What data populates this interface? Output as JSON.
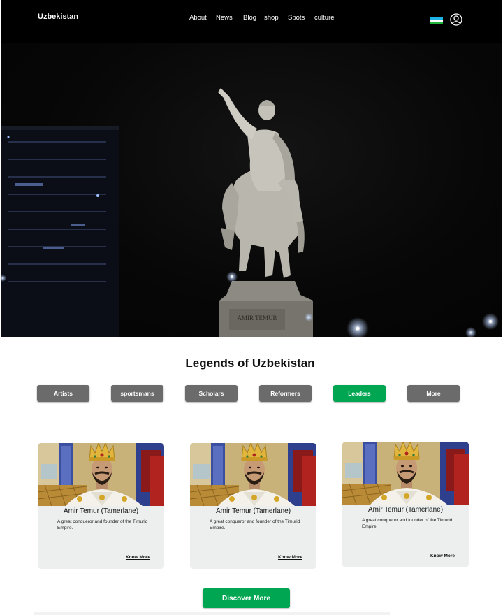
{
  "header": {
    "brand": "Uzbekistan",
    "nav": [
      "About",
      "News",
      "Blog",
      "shop",
      "Spots",
      "culture"
    ],
    "flag_icon": "uzbekistan-flag-icon",
    "user_icon": "user-profile-icon"
  },
  "hero": {
    "monument_plaque": "AMIR TEMUR"
  },
  "legends": {
    "title": "Legends of Uzbekistan",
    "tabs": [
      "Artists",
      "sportsmans",
      "Scholars",
      "Reformers",
      "Leaders",
      "More"
    ],
    "active_tab": "Leaders",
    "cards": [
      {
        "name": "Amir Temur (Tamerlane)",
        "description": "A great conqueror and founder of the Timurid Empire.",
        "link": "Know More"
      },
      {
        "name": "Amir Temur (Tamerlane)",
        "description": "A great conqueror and founder of the Timurid Empire.",
        "link": "Know More"
      },
      {
        "name": "Amir Temur (Tamerlane)",
        "description": "A great conqueror and founder of the Timurid Empire.",
        "link": "Know More"
      }
    ],
    "cta": "Discover More"
  },
  "colors": {
    "accent": "#00a651",
    "tab_inactive": "#6b6b6b",
    "card_bg": "#ecefee",
    "nav_bg": "#000000"
  }
}
